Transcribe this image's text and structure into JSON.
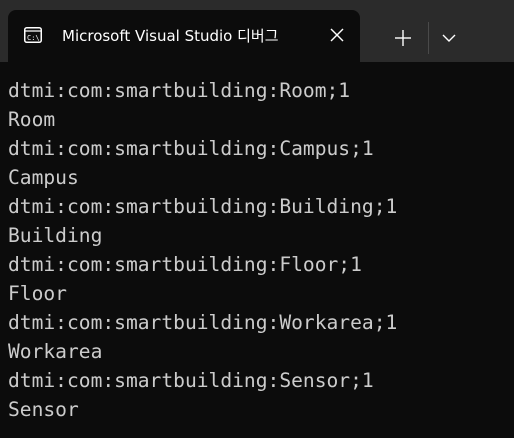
{
  "tab": {
    "title": "Microsoft Visual Studio 디버그",
    "icon": "console-icon"
  },
  "toolbar": {
    "new_tab_icon": "plus-icon",
    "dropdown_icon": "chevron-down-icon"
  },
  "console": {
    "lines": [
      "dtmi:com:smartbuilding:Room;1",
      "Room",
      "dtmi:com:smartbuilding:Campus;1",
      "Campus",
      "dtmi:com:smartbuilding:Building;1",
      "Building",
      "dtmi:com:smartbuilding:Floor;1",
      "Floor",
      "dtmi:com:smartbuilding:Workarea;1",
      "Workarea",
      "dtmi:com:smartbuilding:Sensor;1",
      "Sensor"
    ]
  },
  "colors": {
    "background": "#0c0c0c",
    "tabbar": "#2b2b2b",
    "text": "#cccccc",
    "tab_text": "#ffffff"
  }
}
